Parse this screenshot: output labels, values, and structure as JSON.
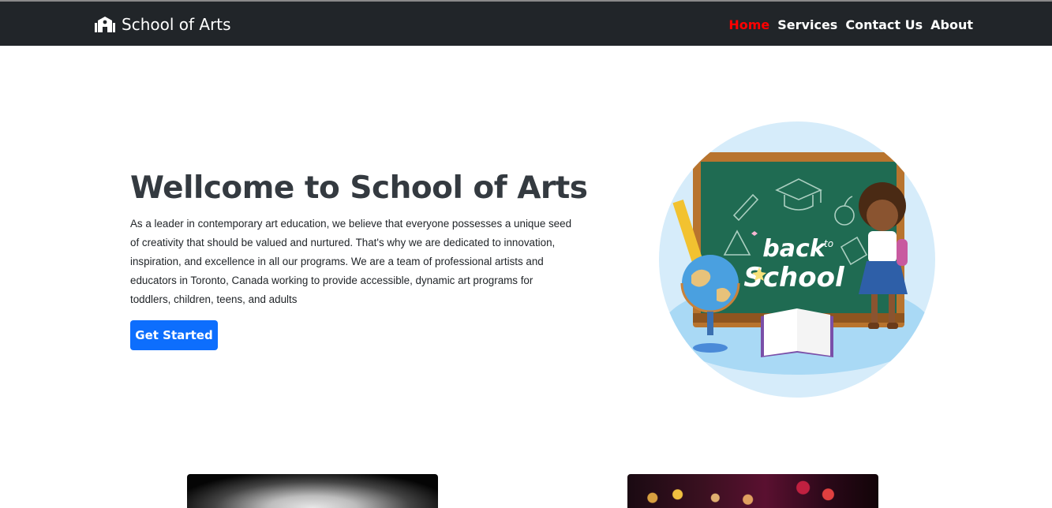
{
  "navbar": {
    "brand": {
      "icon": "school-icon",
      "title": "School of Arts"
    },
    "links": [
      {
        "label": "Home",
        "active": true
      },
      {
        "label": "Services",
        "active": false
      },
      {
        "label": "Contact Us",
        "active": false
      },
      {
        "label": "About",
        "active": false
      }
    ]
  },
  "hero": {
    "title": "Wellcome to School of Arts",
    "description": "As a leader in contemporary art education, we believe that everyone possesses a unique seed of creativity that should be valued and nurtured. That's why we are dedicated to innovation, inspiration, and excellence in all our programs. We are a team of professional artists and educators in Toronto, Canada working to provide accessible, dynamic art programs for toddlers, children, teens, and adults",
    "button_label": "Get Started",
    "illustration_text": [
      "back",
      "to",
      "School"
    ]
  },
  "colors": {
    "navbar_bg": "#212529",
    "active_link": "#ff0000",
    "primary_button": "#0d6efd",
    "chalkboard": "#1f6b52"
  }
}
